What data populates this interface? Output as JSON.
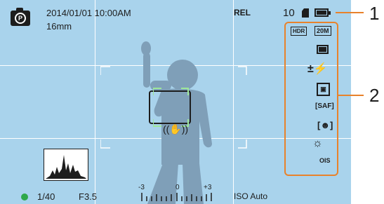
{
  "top": {
    "datetime": "2014/01/01 10:00AM",
    "focal_length": "16mm",
    "rel_label": "REL",
    "shot_count": "10"
  },
  "bottom": {
    "shutter": "1/40",
    "aperture": "F3.5",
    "ev_min": "-3",
    "ev_mid": "0",
    "ev_max": "+3",
    "iso": "ISO Auto"
  },
  "callouts": {
    "one": "1",
    "two": "2"
  },
  "icons": {
    "camera_mode": "camera-p-mode-icon",
    "hdr": "hdr-icon",
    "size": "image-size-20m-icon",
    "quality": "quality-icon",
    "flash": "flash-compensation-icon",
    "metering": "metering-icon",
    "af": "smart-af-icon",
    "face": "face-detection-icon",
    "wb": "white-balance-icon",
    "ois": "ois-icon",
    "battery": "battery-icon",
    "card": "memory-card-icon",
    "shake": "shake-warning-icon"
  },
  "colors": {
    "screen": "#a9d3ec",
    "accent": "#e8822b",
    "focus": "#9ee89a",
    "status_dot": "#2ea84a"
  }
}
